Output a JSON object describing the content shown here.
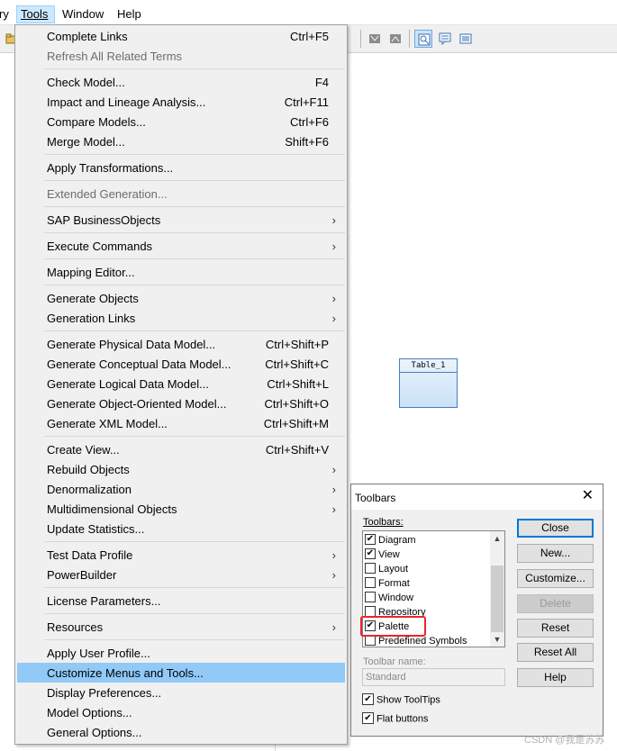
{
  "menubar": {
    "items": [
      "ry",
      "Tools",
      "Window",
      "Help"
    ]
  },
  "canvas": {
    "table_label": "Table_1"
  },
  "tools_menu": {
    "items": [
      {
        "label": "Complete Links",
        "shortcut": "Ctrl+F5"
      },
      {
        "label": "Refresh All Related Terms",
        "shortcut": "",
        "disabled": true
      },
      {
        "label": "Check Model...",
        "shortcut": "F4"
      },
      {
        "label": "Impact and Lineage Analysis...",
        "shortcut": "Ctrl+F11"
      },
      {
        "label": "Compare Models...",
        "shortcut": "Ctrl+F6"
      },
      {
        "label": "Merge Model...",
        "shortcut": "Shift+F6"
      },
      {
        "label": "Apply Transformations...",
        "shortcut": ""
      },
      {
        "label": "Extended Generation...",
        "shortcut": "",
        "disabled": true
      },
      {
        "label": "SAP BusinessObjects",
        "submenu": true
      },
      {
        "label": "Execute Commands",
        "submenu": true
      },
      {
        "label": "Mapping Editor...",
        "shortcut": ""
      },
      {
        "label": "Generate Objects",
        "submenu": true
      },
      {
        "label": "Generation Links",
        "submenu": true
      },
      {
        "label": "Generate Physical Data Model...",
        "shortcut": "Ctrl+Shift+P"
      },
      {
        "label": "Generate Conceptual Data Model...",
        "shortcut": "Ctrl+Shift+C"
      },
      {
        "label": "Generate Logical Data Model...",
        "shortcut": "Ctrl+Shift+L"
      },
      {
        "label": "Generate Object-Oriented Model...",
        "shortcut": "Ctrl+Shift+O"
      },
      {
        "label": "Generate XML Model...",
        "shortcut": "Ctrl+Shift+M"
      },
      {
        "label": "Create View...",
        "shortcut": "Ctrl+Shift+V"
      },
      {
        "label": "Rebuild Objects",
        "submenu": true
      },
      {
        "label": "Denormalization",
        "submenu": true
      },
      {
        "label": "Multidimensional Objects",
        "submenu": true
      },
      {
        "label": "Update Statistics...",
        "shortcut": ""
      },
      {
        "label": "Test Data Profile",
        "submenu": true
      },
      {
        "label": "PowerBuilder",
        "submenu": true
      },
      {
        "label": "License Parameters...",
        "shortcut": ""
      },
      {
        "label": "Resources",
        "submenu": true
      },
      {
        "label": "Apply User Profile...",
        "shortcut": ""
      },
      {
        "label": "Customize Menus and Tools...",
        "shortcut": "",
        "highlighted": true
      },
      {
        "label": "Display Preferences...",
        "shortcut": ""
      },
      {
        "label": "Model Options...",
        "shortcut": ""
      },
      {
        "label": "General Options...",
        "shortcut": ""
      }
    ]
  },
  "toolbars_dialog": {
    "title": "Toolbars",
    "list_label": "Toolbars:",
    "toolbars": [
      {
        "name": "Diagram",
        "checked": true
      },
      {
        "name": "View",
        "checked": true
      },
      {
        "name": "Layout",
        "checked": false
      },
      {
        "name": "Format",
        "checked": false
      },
      {
        "name": "Window",
        "checked": false
      },
      {
        "name": "Repository",
        "checked": false
      },
      {
        "name": "Palette",
        "checked": true
      },
      {
        "name": "Predefined Symbols",
        "checked": false
      }
    ],
    "toolbar_name_label": "Toolbar name:",
    "toolbar_name_value": "Standard",
    "show_tooltips_label": "Show ToolTips",
    "show_tooltips_checked": true,
    "flat_buttons_label": "Flat buttons",
    "flat_buttons_checked": true,
    "buttons": {
      "close": "Close",
      "new": "New...",
      "customize": "Customize...",
      "delete": "Delete",
      "reset": "Reset",
      "reset_all": "Reset All",
      "help": "Help"
    }
  },
  "watermark": "CSDN @我是苏苏",
  "colors": {
    "menu_highlight": "#91c9f7",
    "menubar_active": "#cce8ff",
    "annotation_red": "#e8262a",
    "default_button_border": "#0078d7"
  }
}
